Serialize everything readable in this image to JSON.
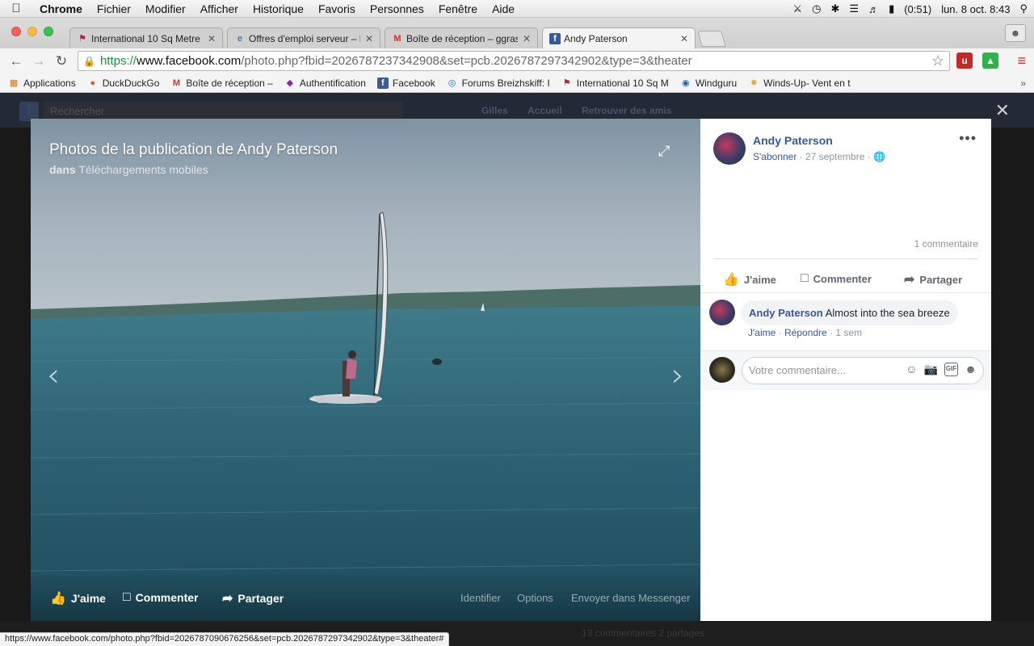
{
  "menubar": {
    "apple": "",
    "app": "Chrome",
    "items": [
      "Fichier",
      "Modifier",
      "Afficher",
      "Historique",
      "Favoris",
      "Personnes",
      "Fenêtre",
      "Aide"
    ],
    "battery": "(0:51)",
    "datetime": "lun. 8 oct.  8:43"
  },
  "tabs": [
    {
      "title": "International 10 Sq Metre"
    },
    {
      "title": "Offres d'emploi serveur – N"
    },
    {
      "title": "Boîte de réception – ggras"
    },
    {
      "title": "Andy Paterson"
    }
  ],
  "address": {
    "scheme": "https://",
    "host": "www.facebook.com",
    "path": "/photo.php?fbid=2026787237342908&set=pcb.2026787297342902&type=3&theater"
  },
  "bookmarks": [
    {
      "label": "Applications",
      "icon": "apps-grid-icon"
    },
    {
      "label": "DuckDuckGo",
      "icon": "duckduckgo-icon"
    },
    {
      "label": "Boîte de réception –",
      "icon": "gmail-icon"
    },
    {
      "label": "Authentification",
      "icon": "auth-icon"
    },
    {
      "label": "Facebook",
      "icon": "facebook-icon"
    },
    {
      "label": "Forums Breizhskiff: I",
      "icon": "forum-icon"
    },
    {
      "label": "International 10 Sq M",
      "icon": "sail-icon"
    },
    {
      "label": "Windguru",
      "icon": "windguru-icon"
    },
    {
      "label": "Winds-Up- Vent en t",
      "icon": "windsup-icon"
    }
  ],
  "bookmarks_more": "»",
  "fb_bg": {
    "search": "Rechercher",
    "user": "Gilles",
    "home": "Accueil",
    "find_friends": "Retrouver des amis"
  },
  "theater": {
    "title": "Photos de la publication de Andy Paterson",
    "sub_prefix": "dans",
    "sub_album": "Téléchargements mobiles",
    "like": "J'aime",
    "comment": "Commenter",
    "share": "Partager",
    "tag": "Identifier",
    "options": "Options",
    "send": "Envoyer dans Messenger",
    "prev": "‹",
    "next": "›",
    "close": "✕"
  },
  "post": {
    "author": "Andy Paterson",
    "follow": "S'abonner",
    "date": "27 septembre",
    "comments_count": "1 commentaire",
    "like": "J'aime",
    "comment": "Commenter",
    "share": "Partager",
    "more": "•••"
  },
  "comment": {
    "author": "Andy Paterson",
    "text": "Almost into the sea breeze",
    "like": "J'aime",
    "reply": "Répondre",
    "time": "1 sem"
  },
  "composer": {
    "placeholder": "Votre commentaire..."
  },
  "bg_bottom": "13 commentaires  2 partages",
  "status_url": "https://www.facebook.com/photo.php?fbid=2026787090676256&set=pcb.2026787297342902&type=3&theater#",
  "colors": {
    "fb_link": "#365899",
    "sea": "#2a5868",
    "sky": "#a9b6bf"
  }
}
